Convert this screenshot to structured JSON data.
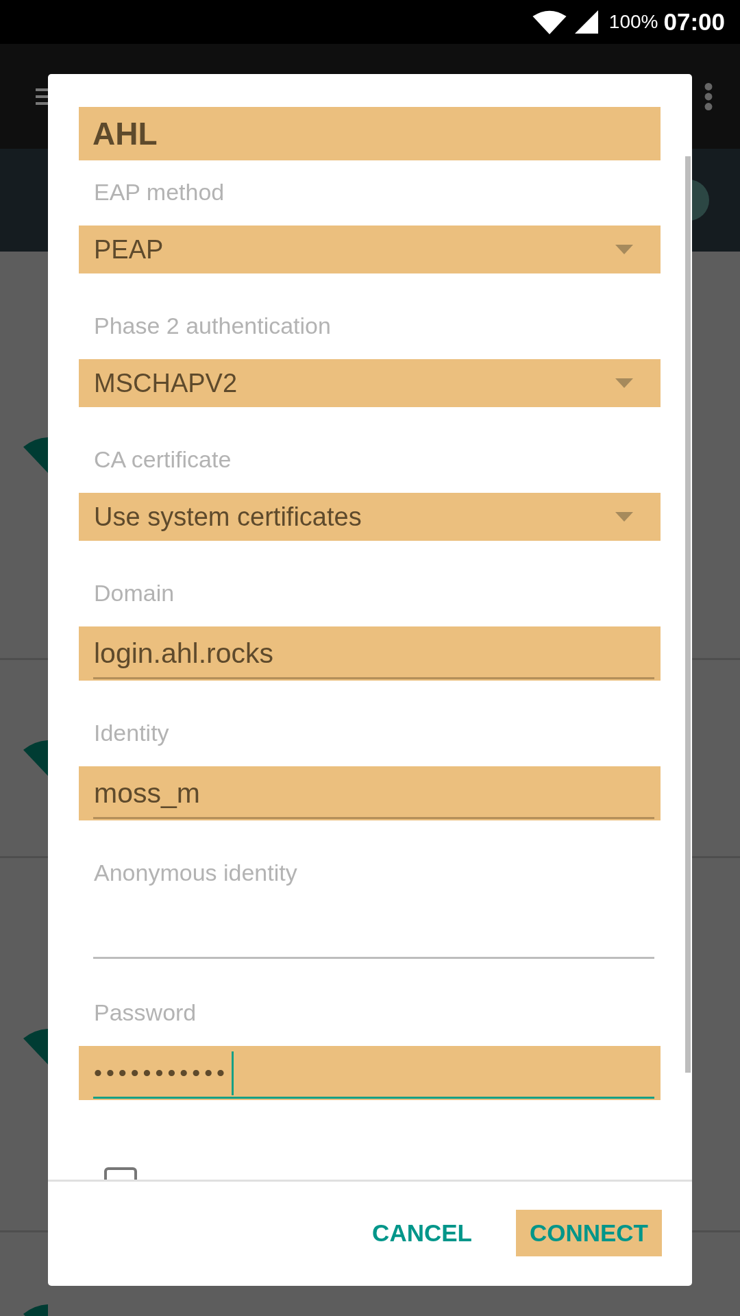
{
  "status_bar": {
    "battery": "100%",
    "time": "07:00"
  },
  "dialog": {
    "title": "AHL",
    "title_highlighted": true,
    "fields": [
      {
        "kind": "spinner",
        "label": "EAP method",
        "value": "PEAP",
        "highlighted": true
      },
      {
        "kind": "spinner",
        "label": "Phase 2 authentication",
        "value": "MSCHAPV2",
        "highlighted": true
      },
      {
        "kind": "spinner",
        "label": "CA certificate",
        "value": "Use system certificates",
        "highlighted": true
      },
      {
        "kind": "text",
        "label": "Domain",
        "value": "login.ahl.rocks",
        "highlighted": true,
        "focused": false
      },
      {
        "kind": "text",
        "label": "Identity",
        "value": "moss_m",
        "highlighted": true,
        "focused": false
      },
      {
        "kind": "text",
        "label": "Anonymous identity",
        "highlighted": false,
        "focused": false
      },
      {
        "kind": "password",
        "label": "Password",
        "value": "•••••••••••",
        "highlighted": true,
        "focused": true
      }
    ],
    "checkbox": {
      "checked": false
    },
    "buttons": [
      {
        "label": "CANCEL",
        "highlighted": false
      },
      {
        "label": "CONNECT",
        "highlighted": true
      }
    ]
  }
}
